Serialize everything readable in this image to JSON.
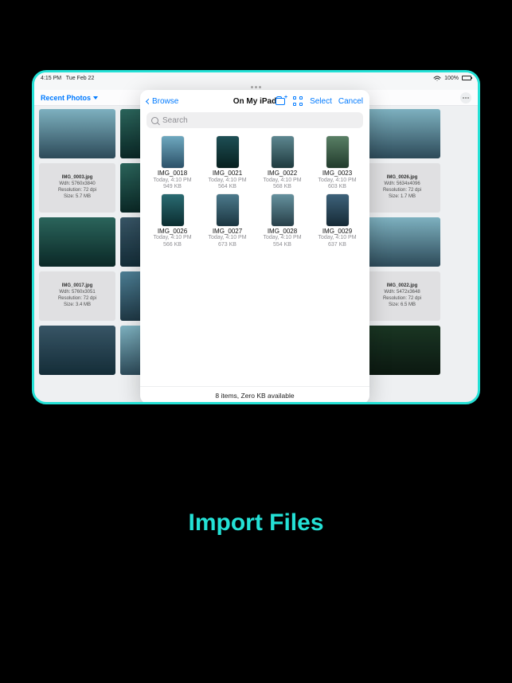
{
  "statusbar": {
    "time": "4:15 PM",
    "date": "Tue Feb 22",
    "battery_label": "100%"
  },
  "app": {
    "recent_label": "Recent Photos"
  },
  "bg_tiles": {
    "left": [
      {
        "filename": "IMG_0003.jpg",
        "line1": "Wdh: 5760x3840",
        "line2": "Resolution: 72 dpi",
        "line3": "Size: 5.7 MB"
      },
      {
        "filename": "IMG_0017.jpg",
        "line1": "Wdh: 5760x3051",
        "line2": "Resolution: 72 dpi",
        "line3": "Size: 3.4 MB"
      }
    ],
    "right": [
      {
        "filename": "IMG_0026.jpg",
        "line1": "Wdh: 5634x4096",
        "line2": "Resolution: 72 dpi",
        "line3": "Size: 1.7 MB"
      },
      {
        "filename": "IMG_0022.jpg",
        "line1": "Wdh: 5472x3648",
        "line2": "Resolution: 72 dpi",
        "line3": "Size: 6.5 MB"
      }
    ]
  },
  "picker": {
    "back_label": "Browse",
    "title": "On My iPad",
    "select_label": "Select",
    "cancel_label": "Cancel",
    "search_placeholder": "Search",
    "footer": "8 items, Zero KB available",
    "files": [
      {
        "name": "IMG_0018",
        "date": "Today, 4:10 PM",
        "size": "949 KB"
      },
      {
        "name": "IMG_0021",
        "date": "Today, 4:10 PM",
        "size": "564 KB"
      },
      {
        "name": "IMG_0022",
        "date": "Today, 4:10 PM",
        "size": "568 KB"
      },
      {
        "name": "IMG_0023",
        "date": "Today, 4:10 PM",
        "size": "603 KB"
      },
      {
        "name": "IMG_0026",
        "date": "Today, 4:10 PM",
        "size": "566 KB"
      },
      {
        "name": "IMG_0027",
        "date": "Today, 4:10 PM",
        "size": "673 KB"
      },
      {
        "name": "IMG_0028",
        "date": "Today, 4:10 PM",
        "size": "554 KB"
      },
      {
        "name": "IMG_0029",
        "date": "Today, 4:10 PM",
        "size": "637 KB"
      }
    ]
  },
  "caption": "Import Files"
}
